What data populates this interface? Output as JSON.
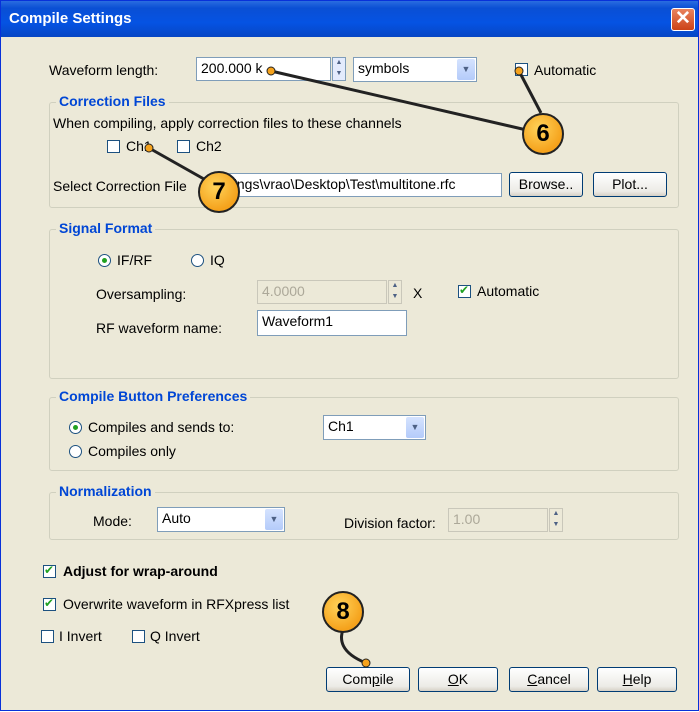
{
  "title": "Compile Settings",
  "waveform_length": {
    "label": "Waveform length:",
    "value": "200.000 k",
    "unit": "symbols",
    "automatic_label": "Automatic",
    "automatic_checked": false
  },
  "correction_files": {
    "title": "Correction Files",
    "instruction": "When compiling, apply correction files to these channels",
    "ch1_label": "Ch1",
    "ch2_label": "Ch2",
    "select_label": "Select Correction File",
    "file_path": "ttings\\vrao\\Desktop\\Test\\multitone.rfc",
    "browse_label": "Browse..",
    "plot_label": "Plot..."
  },
  "signal_format": {
    "title": "Signal Format",
    "ifrf_label": "IF/RF",
    "iq_label": "IQ",
    "selected": "IF/RF",
    "oversampling_label": "Oversampling:",
    "oversampling_value": "4.0000",
    "oversampling_unit": "X",
    "automatic_label": "Automatic",
    "automatic_checked": true,
    "rf_name_label": "RF waveform name:",
    "rf_name_value": "Waveform1"
  },
  "compile_prefs": {
    "title": "Compile Button Preferences",
    "compile_send_label": "Compiles and sends to:",
    "compile_only_label": "Compiles only",
    "channel_value": "Ch1"
  },
  "normalization": {
    "title": "Normalization",
    "mode_label": "Mode:",
    "mode_value": "Auto",
    "division_label": "Division factor:",
    "division_value": "1.00"
  },
  "options": {
    "wrap_label": "Adjust for wrap-around",
    "wrap_checked": true,
    "overwrite_label": "Overwrite waveform in RFXpress list",
    "overwrite_checked": true,
    "i_invert_label": "I Invert",
    "q_invert_label": "Q Invert"
  },
  "buttons": {
    "compile_pre": "Com",
    "compile_key": "p",
    "compile_post": "ile",
    "ok_key": "O",
    "ok_post": "K",
    "cancel_key": "C",
    "cancel_post": "ancel",
    "help_key": "H",
    "help_post": "elp"
  },
  "callouts": {
    "six": "6",
    "seven": "7",
    "eight": "8"
  },
  "colors": {
    "accent": "#0046d5",
    "callout": "#f5a21c"
  }
}
